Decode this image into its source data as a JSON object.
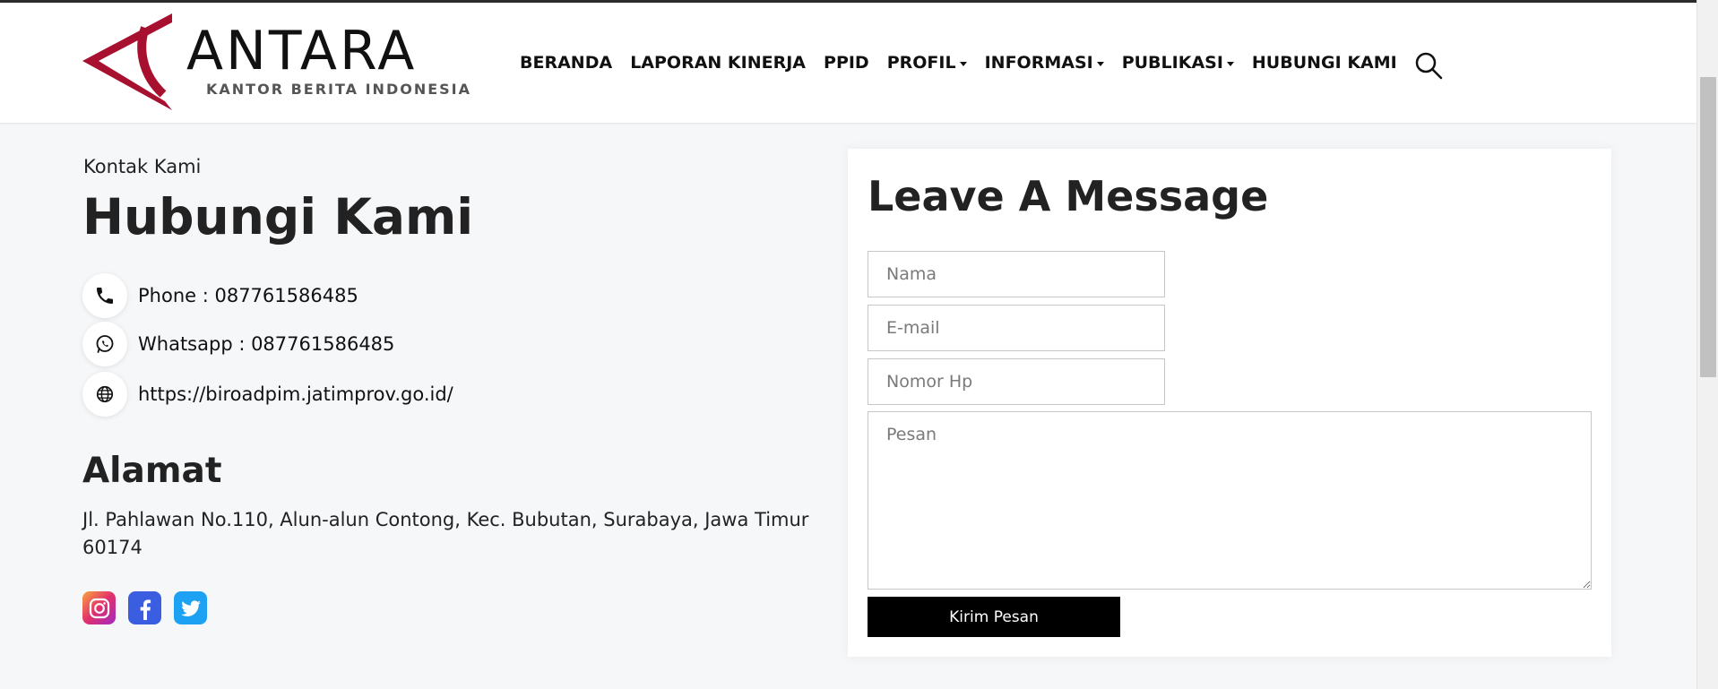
{
  "brand": {
    "name": "ANTARA",
    "tagline": "KANTOR BERITA INDONESIA",
    "color": "#a8102f"
  },
  "nav": {
    "items": [
      {
        "label": "BERANDA",
        "dropdown": false
      },
      {
        "label": "LAPORAN KINERJA",
        "dropdown": false
      },
      {
        "label": "PPID",
        "dropdown": false
      },
      {
        "label": "PROFIL",
        "dropdown": true
      },
      {
        "label": "INFORMASI",
        "dropdown": true
      },
      {
        "label": "PUBLIKASI",
        "dropdown": true
      },
      {
        "label": "HUBUNGI KAMI",
        "dropdown": false
      }
    ],
    "search_icon": "search-icon"
  },
  "contact": {
    "breadcrumb": "Kontak Kami",
    "title": "Hubungi Kami",
    "phone": "Phone : 087761586485",
    "whatsapp": "Whatsapp : 087761586485",
    "website": "https://biroadpim.jatimprov.go.id/"
  },
  "address": {
    "title": "Alamat",
    "text": "Jl. Pahlawan No.110, Alun-alun Contong, Kec. Bubutan, Surabaya, Jawa Timur 60174"
  },
  "socials": [
    {
      "name": "instagram",
      "color": "#e1306c"
    },
    {
      "name": "facebook",
      "color": "#3b5ee0"
    },
    {
      "name": "twitter",
      "color": "#1da1f2"
    }
  ],
  "form": {
    "title": "Leave A Message",
    "name_placeholder": "Nama",
    "email_placeholder": "E-mail",
    "phone_placeholder": "Nomor Hp",
    "message_placeholder": "Pesan",
    "submit_label": "Kirim Pesan"
  }
}
